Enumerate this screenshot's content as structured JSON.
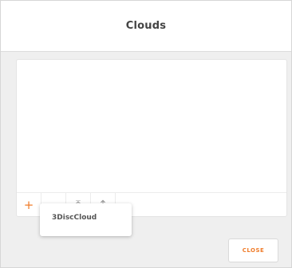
{
  "dialog": {
    "title": "Clouds",
    "close_label": "CLOSE"
  },
  "toolbar": {
    "add": "+",
    "remove": "−",
    "move_top": "⤒",
    "move_up": "↑"
  },
  "popup": {
    "items": [
      {
        "label": "3DiscCloud"
      }
    ]
  },
  "colors": {
    "accent": "#f07c2a",
    "dialog_background": "#efefef",
    "panel_background": "#ffffff"
  }
}
